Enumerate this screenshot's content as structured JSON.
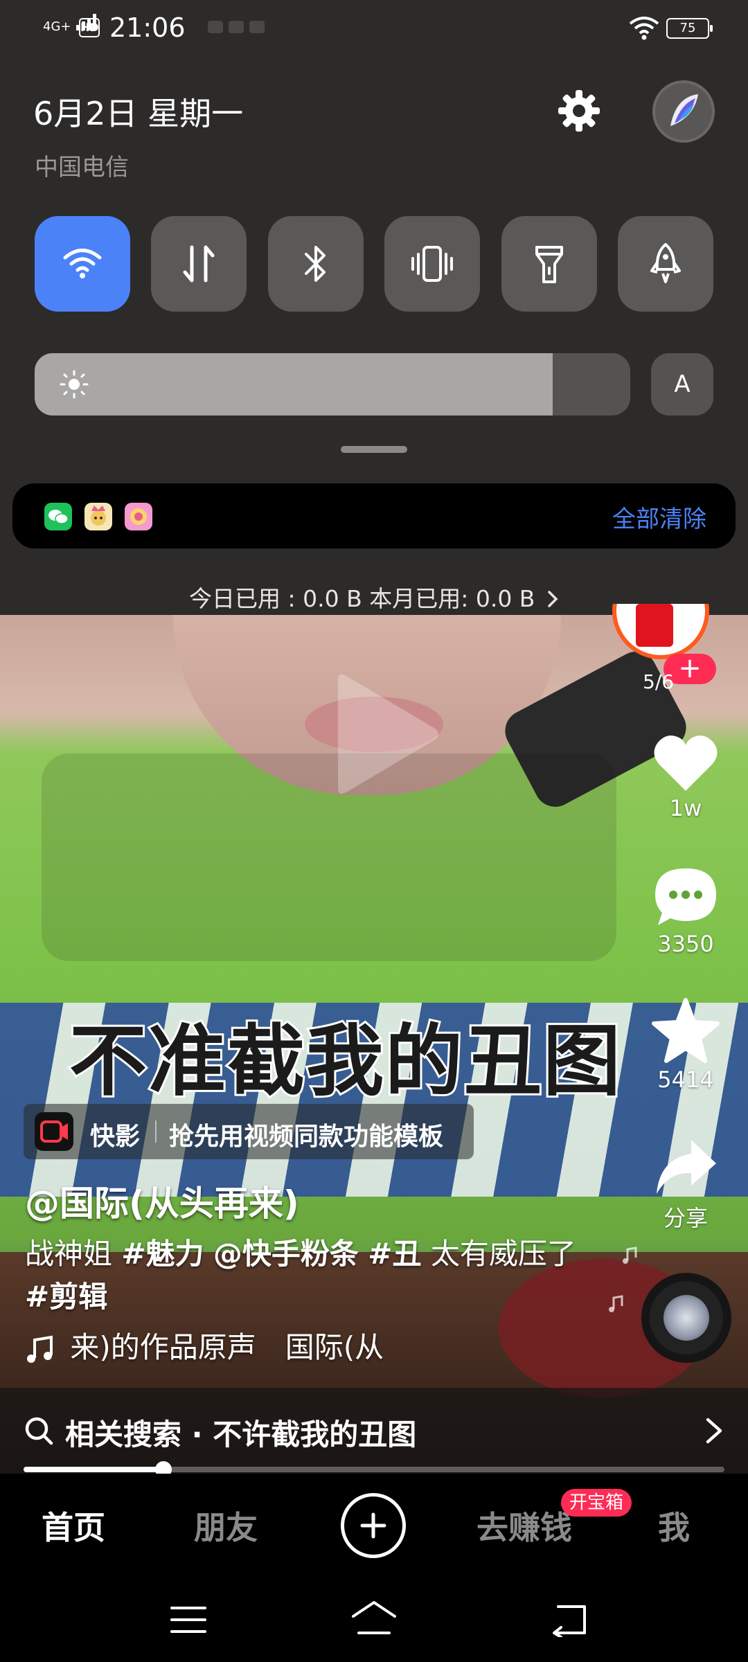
{
  "status_bar": {
    "network": "4G+",
    "hd": "HD",
    "time": "21:06",
    "battery": "75"
  },
  "shade": {
    "date": "6月2日 星期一",
    "carrier": "中国电信",
    "tiles": [
      {
        "name": "wifi",
        "on": true
      },
      {
        "name": "mobile-data",
        "on": false
      },
      {
        "name": "bluetooth",
        "on": false
      },
      {
        "name": "vibrate",
        "on": false
      },
      {
        "name": "flashlight",
        "on": false
      },
      {
        "name": "airplane-mode",
        "on": false
      }
    ],
    "brightness_level": 0.87,
    "auto_brightness_label": "A",
    "clear_all_label": "全部清除",
    "usage_text": "今日已用 : 0.0 B 本月已用: 0.0 B"
  },
  "video": {
    "caption_overlay": "不准截我的丑图",
    "page_count": "5/6",
    "likes": "1w",
    "comments": "3350",
    "favorites": "5414",
    "share_label": "分享",
    "promo_brand": "快影",
    "promo_text": "抢先用视频同款功能模板",
    "author": "@国际(从头再来)",
    "description": {
      "part1": "战神姐 ",
      "tag1": "#魅力",
      "part2": " ",
      "mention": "@快手粉条",
      "part3": " ",
      "tag2": "#丑",
      "part4": " 太有威压了 ",
      "tag3": "#剪辑"
    },
    "music": "来)的作品原声　国际(从",
    "related_search": "相关搜索 · 不许截我的丑图",
    "progress": 0.2
  },
  "tabbar": {
    "home": "首页",
    "friends": "朋友",
    "earn": "去赚钱",
    "earn_badge": "开宝箱",
    "me": "我"
  },
  "colors": {
    "accent_blue": "#4c82f7",
    "brand_red": "#fe2c55"
  }
}
